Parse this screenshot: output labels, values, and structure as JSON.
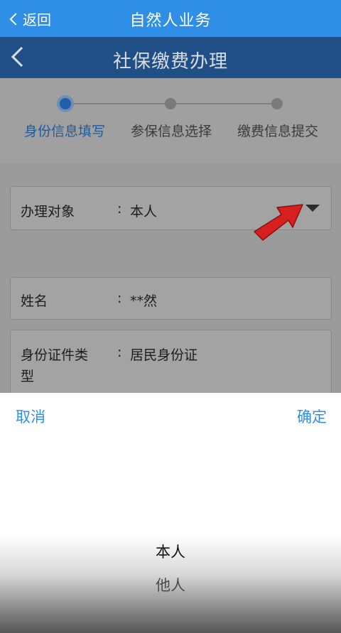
{
  "topbar": {
    "back_label": "返回",
    "title": "自然人业务"
  },
  "subbar": {
    "title": "社保缴费办理"
  },
  "stepper": {
    "steps": [
      {
        "label": "身份信息填写",
        "active": true
      },
      {
        "label": "参保信息选择",
        "active": false
      },
      {
        "label": "缴费信息提交",
        "active": false
      }
    ]
  },
  "form": {
    "target": {
      "label": "办理对象",
      "separator": ":",
      "value": "本人"
    },
    "name": {
      "label": "姓名",
      "separator": ":",
      "value": "**然"
    },
    "id_type": {
      "label_line1": "身份证件类",
      "label_line2": "型",
      "separator": ":",
      "value": "居民身份证"
    }
  },
  "picker": {
    "cancel_label": "取消",
    "confirm_label": "确定",
    "options": [
      "本人",
      "他人"
    ],
    "selected": "本人"
  },
  "colors": {
    "accent": "#2f8fe6",
    "header_dark": "#1f4f86",
    "annotation_arrow": "#d81f1f"
  }
}
